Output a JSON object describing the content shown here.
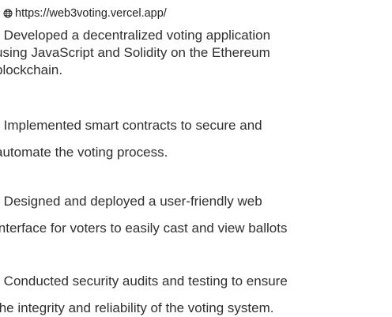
{
  "link": {
    "icon": "globe-icon",
    "url": "https://web3voting.vercel.app/"
  },
  "bullets": [
    {
      "lines": [
        "• Developed a decentralized voting application",
        "using JavaScript and Solidity on the Ethereum",
        "blockchain."
      ]
    },
    {
      "lines": [
        "• Implemented smart contracts to secure and",
        "automate the voting process."
      ]
    },
    {
      "lines": [
        "• Designed and deployed a user-friendly web",
        "interface for voters to easily cast and view ballots"
      ]
    },
    {
      "lines": [
        "• Conducted security audits and testing to ensure",
        "the integrity and reliability of the voting system."
      ]
    }
  ]
}
